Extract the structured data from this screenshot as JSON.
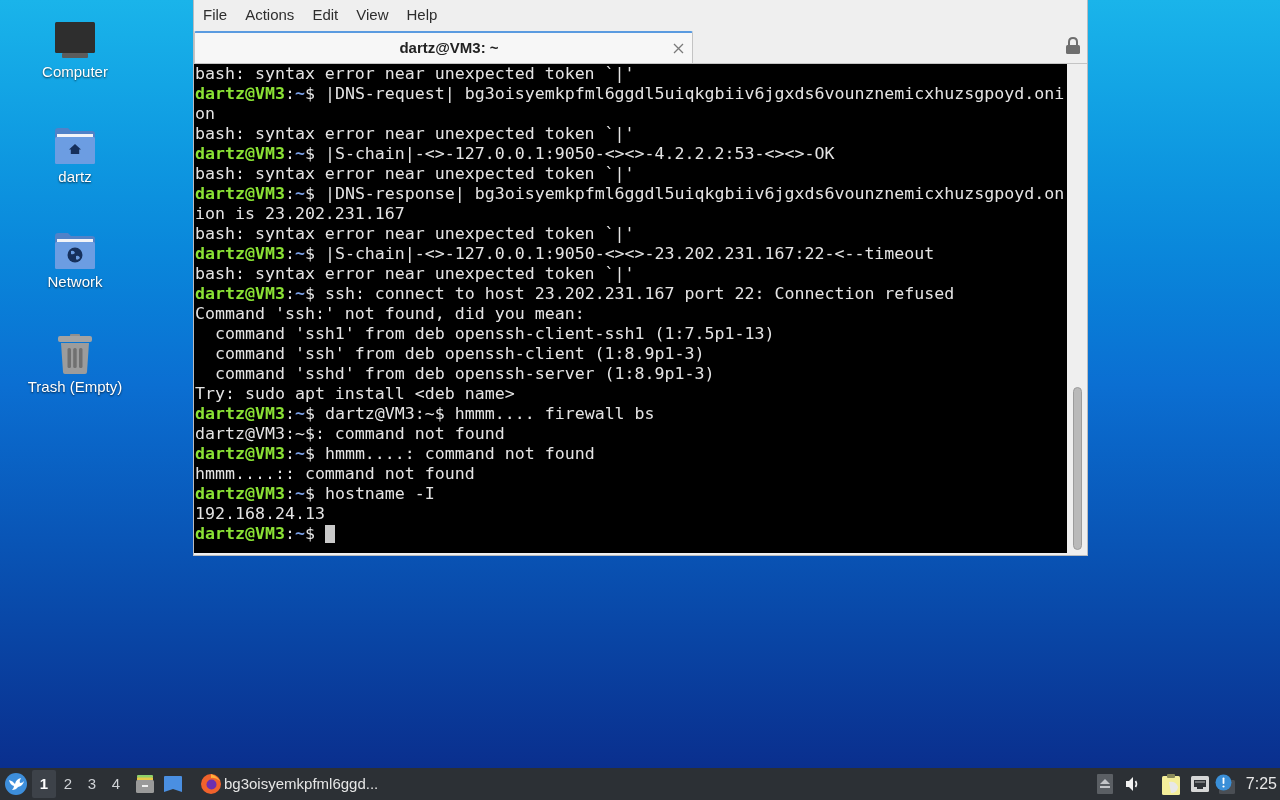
{
  "desktop": {
    "shortcuts": [
      {
        "kind": "computer",
        "label": "Computer"
      },
      {
        "kind": "home",
        "label": "dartz"
      },
      {
        "kind": "network",
        "label": "Network"
      },
      {
        "kind": "trash",
        "label": "Trash (Empty)"
      }
    ]
  },
  "terminal": {
    "menu": [
      "File",
      "Actions",
      "Edit",
      "View",
      "Help"
    ],
    "tabs": [
      {
        "title": "dartz@VM3: ~",
        "selected": true
      }
    ],
    "lines": [
      {
        "kind": "output",
        "text": "bash: syntax error near unexpected token `|'"
      },
      {
        "kind": "prompt",
        "user": "dartz@VM3",
        "separator": ":",
        "path": "~",
        "symbol": "$",
        "command": "|DNS-request| bg3oisyemkpfml6ggdl5uiqkgbiiv6jgxds6vounznemicxhuzsgpoyd.oni"
      },
      {
        "kind": "output",
        "text": "on"
      },
      {
        "kind": "output",
        "text": "bash: syntax error near unexpected token `|'"
      },
      {
        "kind": "prompt",
        "user": "dartz@VM3",
        "separator": ":",
        "path": "~",
        "symbol": "$",
        "command": "|S-chain|-<>-127.0.0.1:9050-<><>-4.2.2.2:53-<><>-OK"
      },
      {
        "kind": "output",
        "text": "bash: syntax error near unexpected token `|'"
      },
      {
        "kind": "prompt",
        "user": "dartz@VM3",
        "separator": ":",
        "path": "~",
        "symbol": "$",
        "command": "|DNS-response| bg3oisyemkpfml6ggdl5uiqkgbiiv6jgxds6vounznemicxhuzsgpoyd.on"
      },
      {
        "kind": "output",
        "text": "ion is 23.202.231.167"
      },
      {
        "kind": "output",
        "text": "bash: syntax error near unexpected token `|'"
      },
      {
        "kind": "prompt",
        "user": "dartz@VM3",
        "separator": ":",
        "path": "~",
        "symbol": "$",
        "command": "|S-chain|-<>-127.0.0.1:9050-<><>-23.202.231.167:22-<--timeout"
      },
      {
        "kind": "output",
        "text": "bash: syntax error near unexpected token `|'"
      },
      {
        "kind": "prompt",
        "user": "dartz@VM3",
        "separator": ":",
        "path": "~",
        "symbol": "$",
        "command": "ssh: connect to host 23.202.231.167 port 22: Connection refused"
      },
      {
        "kind": "output",
        "text": "Command 'ssh:' not found, did you mean:"
      },
      {
        "kind": "output",
        "text": "  command 'ssh1' from deb openssh-client-ssh1 (1:7.5p1-13)"
      },
      {
        "kind": "output",
        "text": "  command 'ssh' from deb openssh-client (1:8.9p1-3)"
      },
      {
        "kind": "output",
        "text": "  command 'sshd' from deb openssh-server (1:8.9p1-3)"
      },
      {
        "kind": "output",
        "text": "Try: sudo apt install <deb name>"
      },
      {
        "kind": "prompt",
        "user": "dartz@VM3",
        "separator": ":",
        "path": "~",
        "symbol": "$",
        "command": "dartz@VM3:~$ hmmm.... firewall bs"
      },
      {
        "kind": "output",
        "text": "dartz@VM3:~$: command not found"
      },
      {
        "kind": "prompt",
        "user": "dartz@VM3",
        "separator": ":",
        "path": "~",
        "symbol": "$",
        "command": "hmmm....: command not found"
      },
      {
        "kind": "output",
        "text": "hmmm....:: command not found"
      },
      {
        "kind": "prompt",
        "user": "dartz@VM3",
        "separator": ":",
        "path": "~",
        "symbol": "$",
        "command": "hostname -I"
      },
      {
        "kind": "output",
        "text": "192.168.24.13"
      },
      {
        "kind": "prompt",
        "user": "dartz@VM3",
        "separator": ":",
        "path": "~",
        "symbol": "$",
        "cursor": true
      }
    ]
  },
  "taskbar": {
    "workspaces": [
      {
        "label": "1",
        "selected": true
      },
      {
        "label": "2",
        "selected": false
      },
      {
        "label": "3",
        "selected": false
      },
      {
        "label": "4",
        "selected": false
      }
    ],
    "tasks": [
      {
        "title": "bg3oisyemkpfml6ggd..."
      }
    ],
    "clock": "7:25"
  }
}
